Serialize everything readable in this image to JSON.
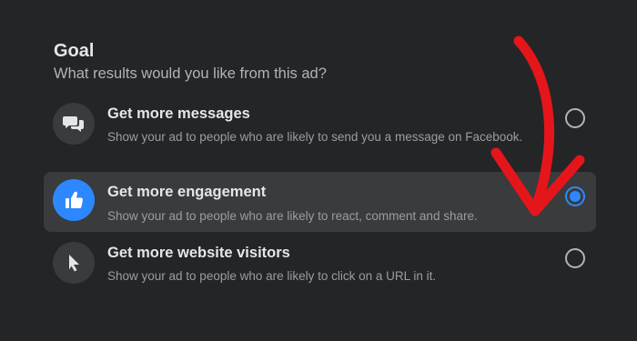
{
  "goal": {
    "title": "Goal",
    "subtitle": "What results would you like from this ad?"
  },
  "options": [
    {
      "title": "Get more messages",
      "description": "Show your ad to people who are likely to send you a message on Facebook.",
      "icon": "chat-bubbles-icon",
      "selected": false
    },
    {
      "title": "Get more engagement",
      "description": "Show your ad to people who are likely to react, comment and share.",
      "icon": "thumbs-up-icon",
      "selected": true
    },
    {
      "title": "Get more website visitors",
      "description": "Show your ad to people who are likely to click on a URL in it.",
      "icon": "cursor-icon",
      "selected": false
    }
  ],
  "colors": {
    "background": "#242526",
    "selected_row": "#3a3b3c",
    "accent": "#2d88ff",
    "annotation_arrow": "#e4161b"
  }
}
